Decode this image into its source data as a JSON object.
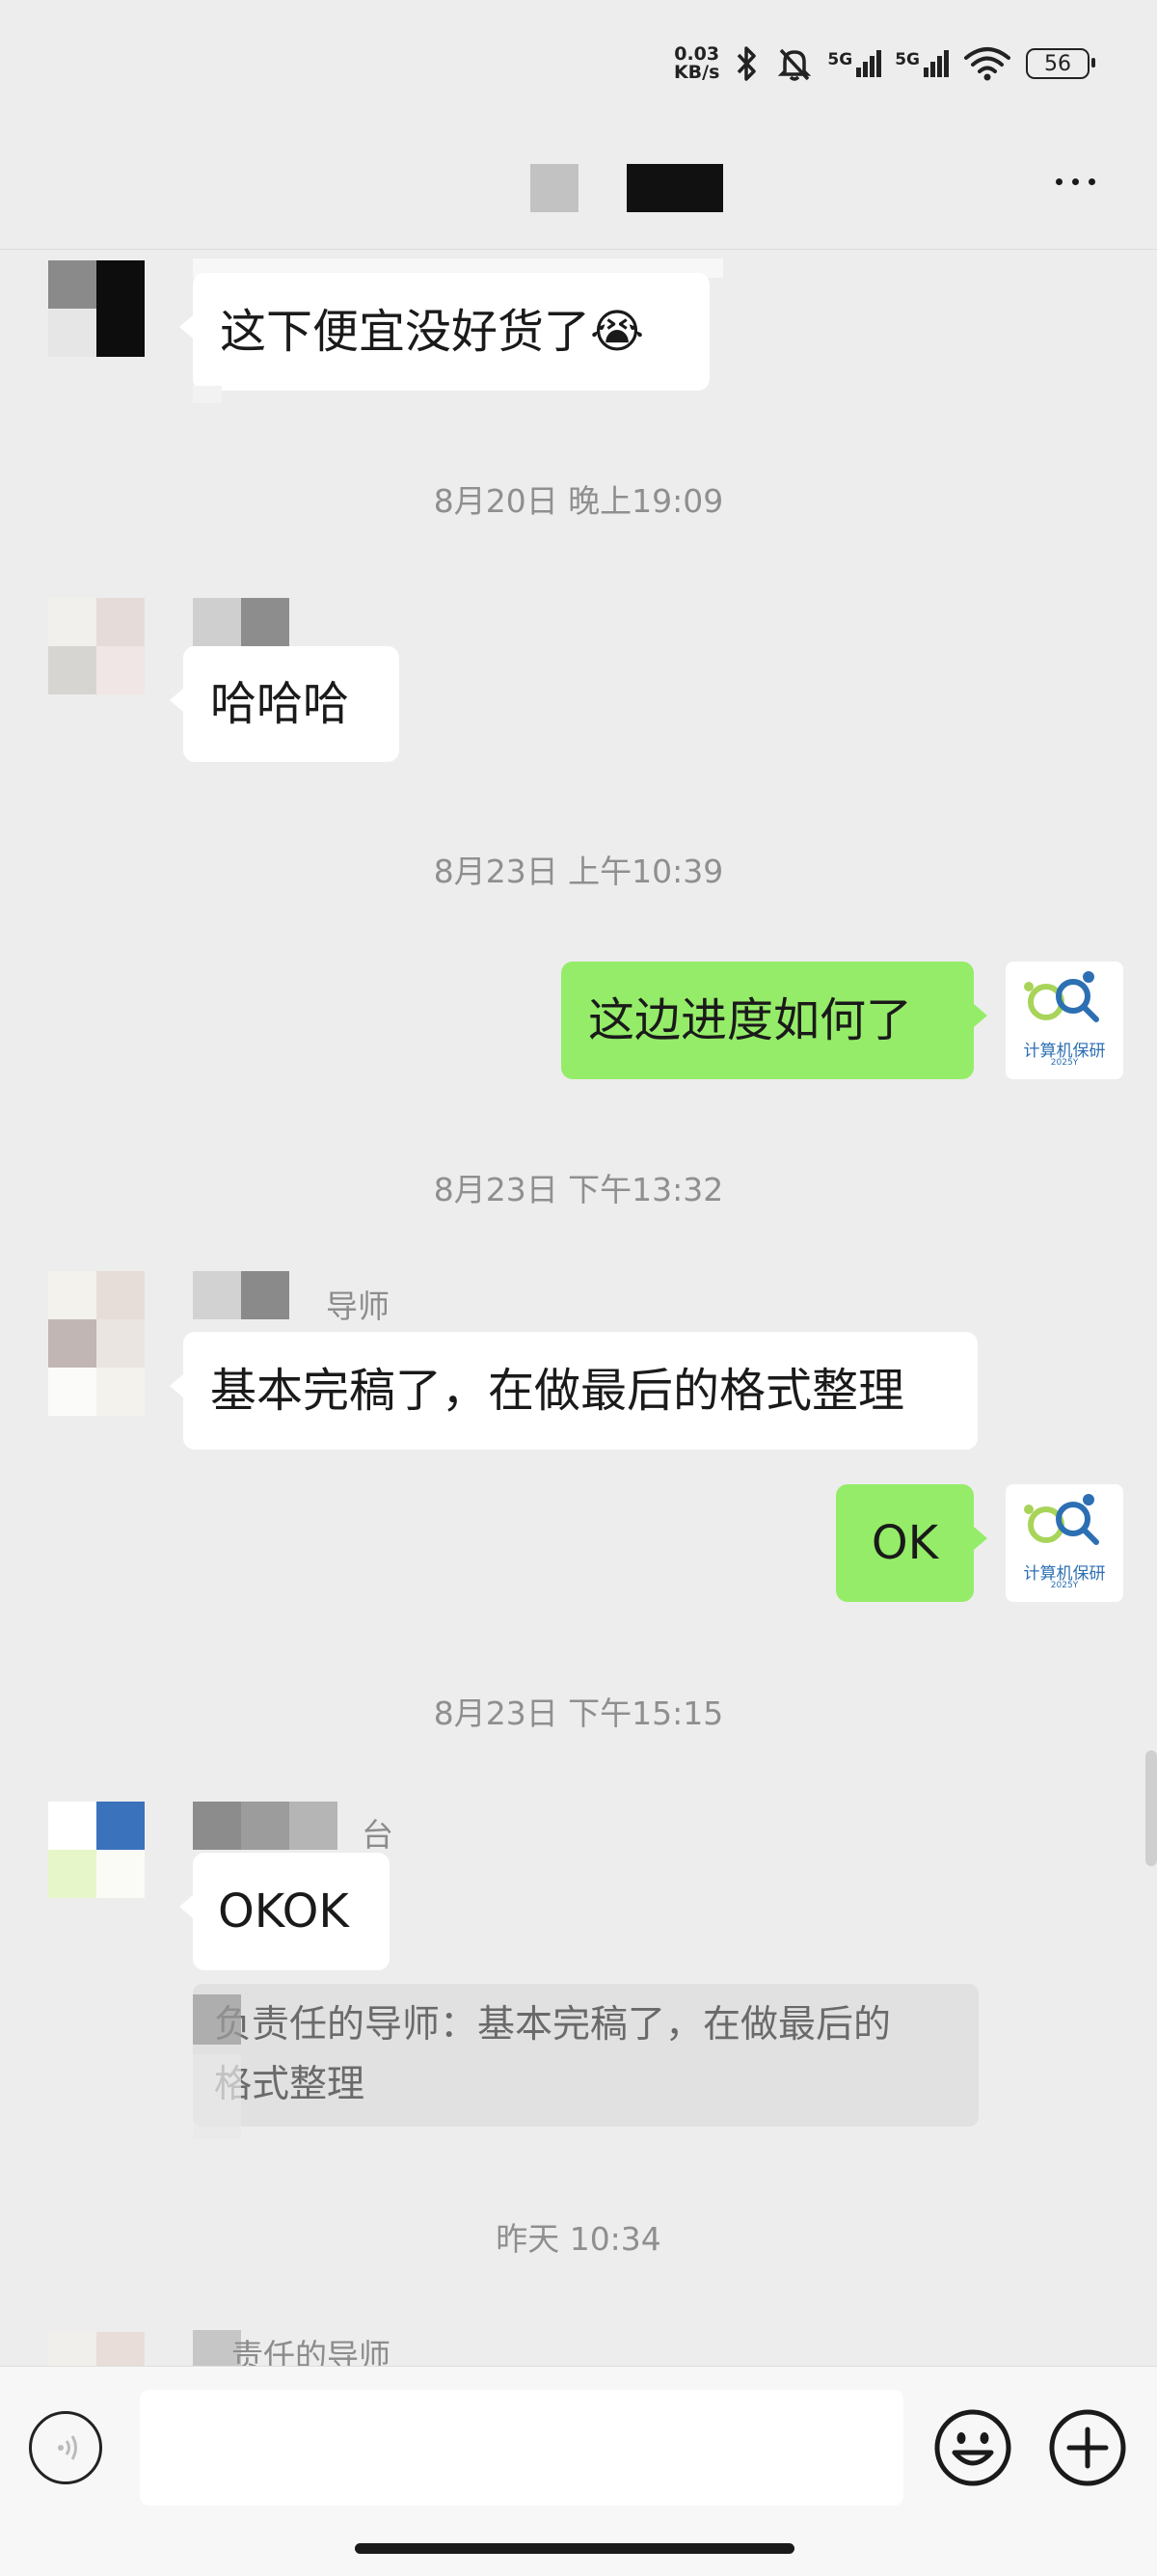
{
  "status_bar": {
    "net_speed_value": "0.03",
    "net_speed_unit": "KB/s",
    "sim1_label": "5G",
    "sim2_label": "5G",
    "battery": "56"
  },
  "messages": [
    {
      "type": "left",
      "text": "这下便宜没好货了😭"
    },
    {
      "type": "time",
      "text": "8月20日 晚上19:09"
    },
    {
      "type": "left",
      "text": "哈哈哈"
    },
    {
      "type": "time",
      "text": "8月23日 上午10:39"
    },
    {
      "type": "right",
      "text": "这边进度如何了"
    },
    {
      "type": "time",
      "text": "8月23日 下午13:32"
    },
    {
      "type": "left",
      "nick": "导师",
      "text": "基本完稿了，在做最后的格式整理"
    },
    {
      "type": "right",
      "text": "OK"
    },
    {
      "type": "time",
      "text": "8月23日 下午15:15"
    },
    {
      "type": "left",
      "nick": "台",
      "text": "OKOK",
      "quote": [
        "负责任的导师：基本完稿了，在做最后的",
        "格式整理"
      ]
    },
    {
      "type": "time",
      "text": "昨天 10:34"
    },
    {
      "type": "left",
      "nick": "责任的导师"
    }
  ],
  "my_avatar": {
    "text": "计算机保研",
    "sub": "2025Y"
  },
  "input": {
    "placeholder": ""
  },
  "icons": {
    "bluetooth": "bluetooth-icon",
    "mute": "bell-off-icon",
    "wifi": "wifi-icon",
    "more": "more-icon",
    "voice": "voice-icon",
    "emoji": "emoji-icon",
    "add": "plus-circle-icon"
  },
  "colors": {
    "background": "#ededed",
    "my_bubble": "#95ec69",
    "their_bubble": "#ffffff"
  }
}
